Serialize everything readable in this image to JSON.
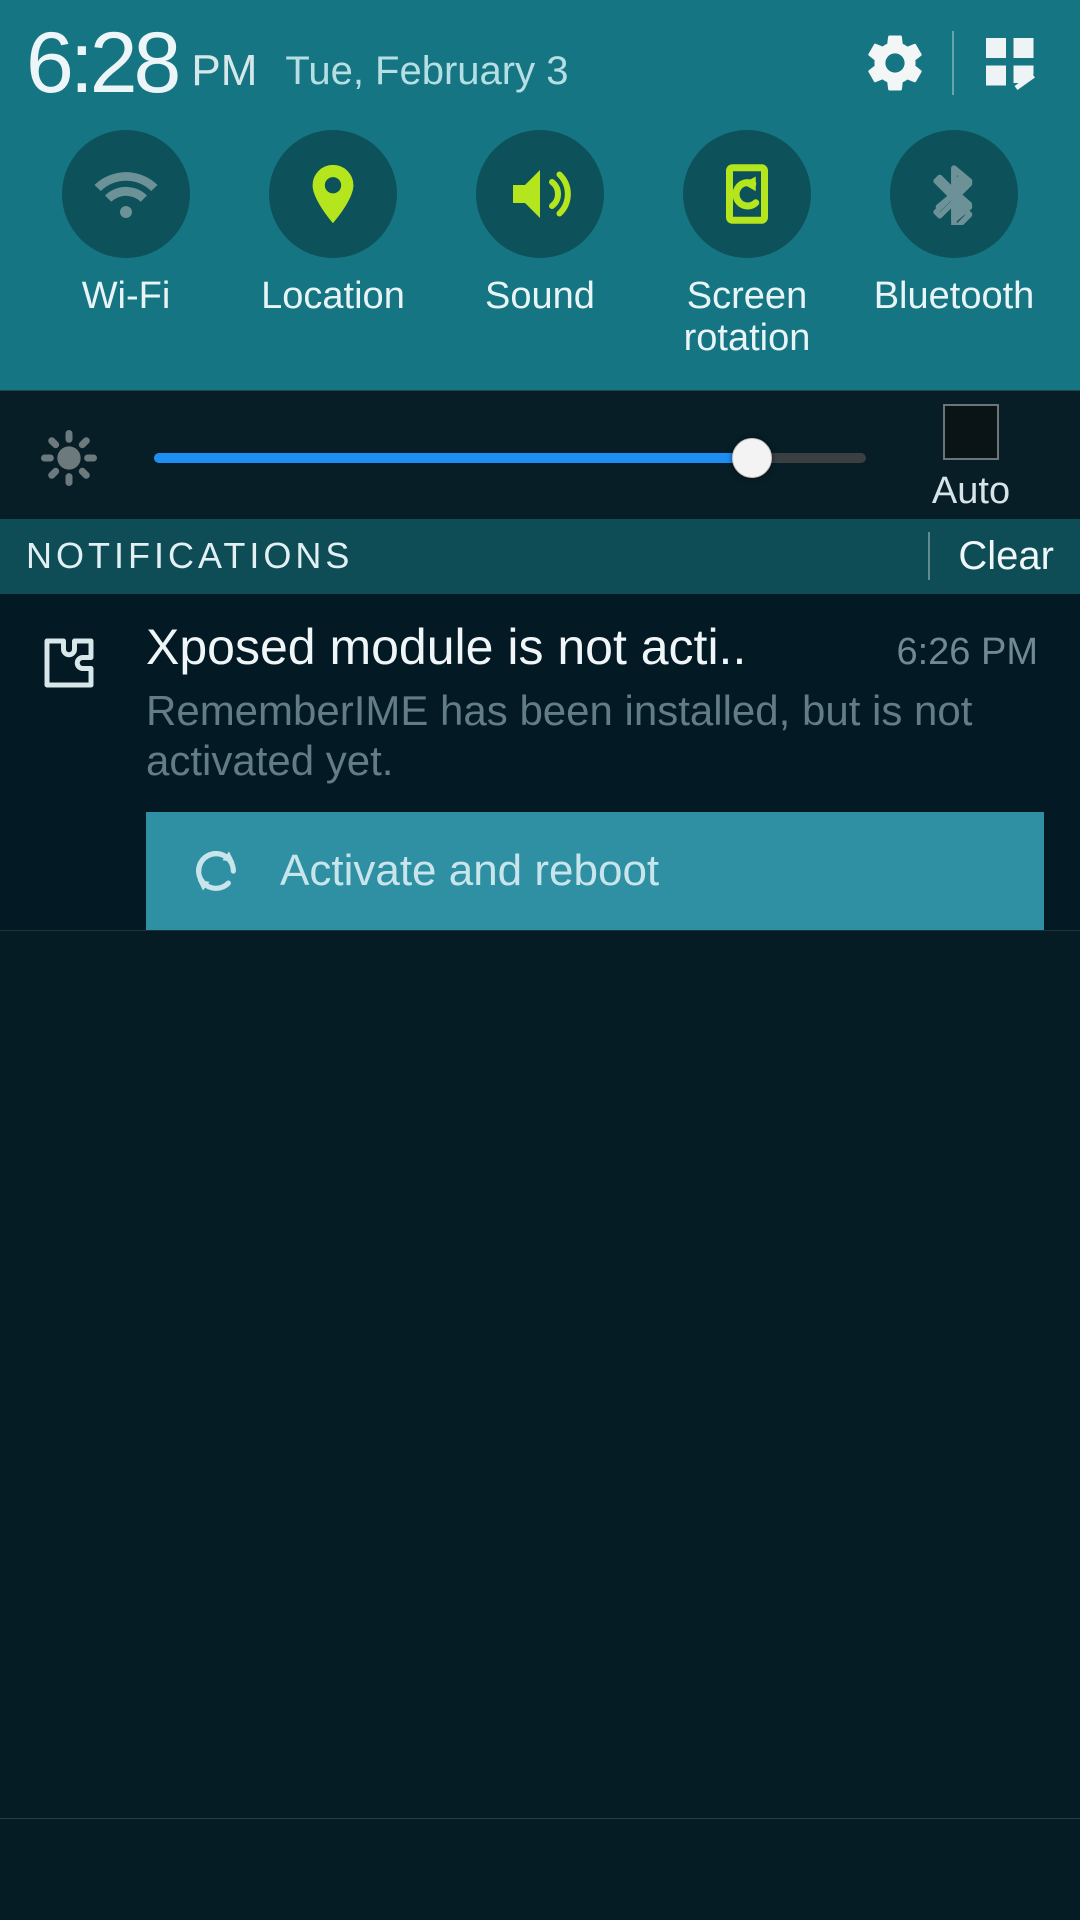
{
  "status": {
    "time": "6:28",
    "ampm": "PM",
    "date": "Tue, February 3"
  },
  "toggles": [
    {
      "key": "wifi",
      "label": "Wi-Fi",
      "active": false
    },
    {
      "key": "location",
      "label": "Location",
      "active": true
    },
    {
      "key": "sound",
      "label": "Sound",
      "active": true
    },
    {
      "key": "rotation",
      "label": "Screen\nrotation",
      "active": true
    },
    {
      "key": "bluetooth",
      "label": "Bluetooth",
      "active": false
    }
  ],
  "brightness": {
    "value_pct": 84,
    "auto_label": "Auto",
    "auto_checked": false
  },
  "notif_header": {
    "label": "NOTIFICATIONS",
    "clear": "Clear"
  },
  "notification": {
    "title": "Xposed module is not acti..",
    "time": "6:26 PM",
    "body": "RememberIME has been installed, but is not activated yet.",
    "action": "Activate and reboot"
  },
  "colors": {
    "teal_panel": "#167582",
    "toggle_bg": "#0d515b",
    "accent_active": "#b5e61d",
    "inactive_icon": "#6c9297",
    "slider_fill": "#1e8ef2",
    "action_bg": "#2f90a3",
    "action_fg": "#c8e5eb"
  }
}
